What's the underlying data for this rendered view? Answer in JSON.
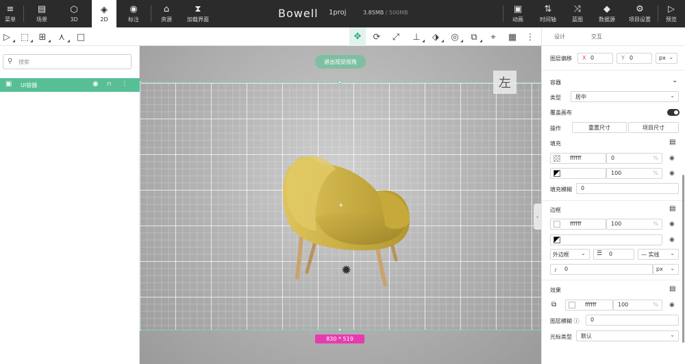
{
  "topbar": {
    "buttons": [
      {
        "icon": "≡",
        "label": "菜单"
      },
      {
        "icon": "▤",
        "label": "场景"
      },
      {
        "icon": "⬡",
        "label": "3D"
      },
      {
        "icon": "◈",
        "label": "2D"
      },
      {
        "icon": "◉",
        "label": "标注"
      },
      {
        "icon": "⌂",
        "label": "资源"
      },
      {
        "icon": "⧗",
        "label": "加载界面"
      }
    ],
    "brand": "Bowell",
    "project": "1proj",
    "memory_used": "3.85MB",
    "memory_total": "/ 500MB",
    "right_buttons": [
      {
        "icon": "▣",
        "label": "动画"
      },
      {
        "icon": "⇅",
        "label": "时间轴"
      },
      {
        "icon": "⤨",
        "label": "蓝图"
      },
      {
        "icon": "◆",
        "label": "数据源"
      },
      {
        "icon": "⚙",
        "label": "项目设置"
      },
      {
        "icon": "▷",
        "label": "预览"
      }
    ]
  },
  "toolbar_left": [
    "▷",
    "⬚",
    "⊞",
    "⋏",
    "□"
  ],
  "toolbar_center": [
    "✥",
    "⟳",
    "⤢",
    "⊥",
    "⬗",
    "◎",
    "⧉",
    "⌖",
    "▦",
    "⋮"
  ],
  "search": {
    "placeholder": "搜索"
  },
  "layer": {
    "icon": "▣",
    "name": "UI容器",
    "eye": "◉",
    "lock": "🔒",
    "more": "⋮"
  },
  "viewport": {
    "exit_label": "退出视觉视角",
    "view_label": "左",
    "dimension": "830 * 519"
  },
  "panel": {
    "tabs": [
      "设计",
      "交互"
    ],
    "offset": {
      "label": "图层偏移",
      "x": "0",
      "y": "0",
      "unit": "px"
    },
    "container": {
      "title": "容器",
      "type_label": "类型",
      "type_value": "居中",
      "cover_label": "覆盖画布",
      "op_label": "操作",
      "reset_size": "重置尺寸",
      "project_size": "项目尺寸"
    },
    "fill": {
      "title": "填充",
      "color1": "ffffff",
      "val1": "0",
      "val2": "100",
      "blur_label": "填充模糊",
      "blur_value": "0"
    },
    "border": {
      "title": "边框",
      "color": "ffffff",
      "opacity": "100",
      "style_label": "外边框",
      "width": "0",
      "line": "— 实线",
      "radius": "0",
      "unit": "px"
    },
    "effect": {
      "title": "效果",
      "color": "ffffff",
      "opacity": "100",
      "layer_blur_label": "图层模糊",
      "layer_blur_value": "0",
      "cursor_label": "光标类型",
      "cursor_value": "默认"
    }
  },
  "colors": {
    "accent": "#57be95",
    "topbar": "#2b2b2b",
    "badge": "#e83bb0"
  }
}
